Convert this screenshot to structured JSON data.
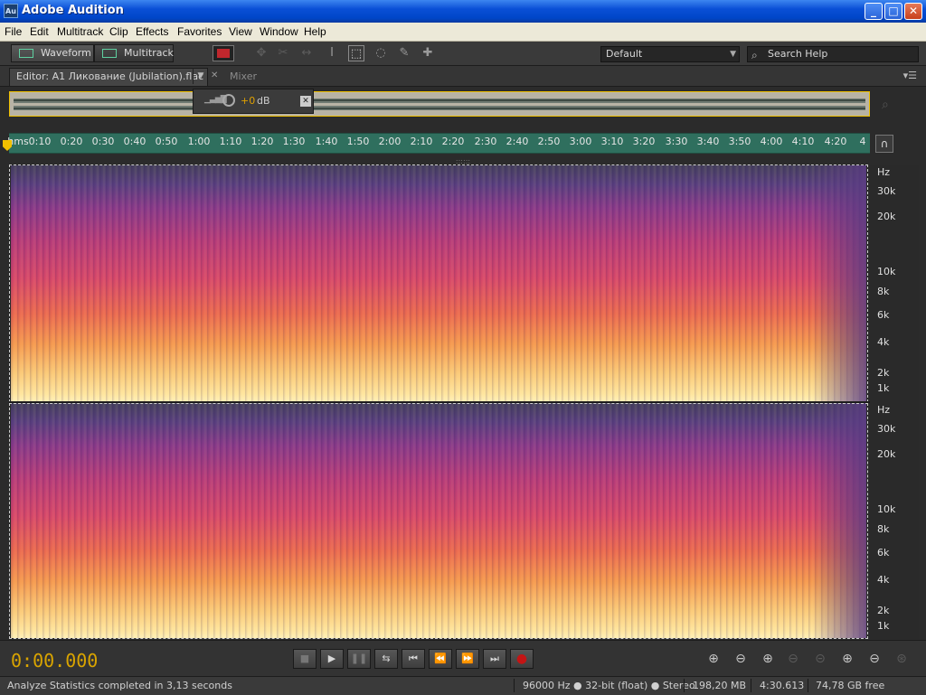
{
  "window": {
    "app_icon": "Au",
    "title": "Adobe Audition",
    "btn_min": "_",
    "btn_max": "□",
    "btn_close": "✕"
  },
  "menu": [
    "File",
    "Edit",
    "Multitrack",
    "Clip",
    "Effects",
    "Favorites",
    "View",
    "Window",
    "Help"
  ],
  "toolbar": {
    "waveform_label": "Waveform",
    "multitrack_label": "Multitrack",
    "workspace": "Default",
    "search_placeholder": "Search Help"
  },
  "panel": {
    "editor_tab": "Editor: A1 Ликование (Jubilation).flac",
    "mixer_tab": "Mixer"
  },
  "hud": {
    "volume": "+0",
    "unit": "dB"
  },
  "ruler": {
    "labels": [
      "hms",
      "0:10",
      "0:20",
      "0:30",
      "0:40",
      "0:50",
      "1:00",
      "1:10",
      "1:20",
      "1:30",
      "1:40",
      "1:50",
      "2:00",
      "2:10",
      "2:20",
      "2:30",
      "2:40",
      "2:50",
      "3:00",
      "3:10",
      "3:20",
      "3:30",
      "3:40",
      "3:50",
      "4:00",
      "4:10",
      "4:20",
      "4"
    ]
  },
  "freq_scale": {
    "unit": "Hz",
    "labels": [
      "30k",
      "20k",
      "10k",
      "8k",
      "6k",
      "4k",
      "2k",
      "1k"
    ]
  },
  "transport": {
    "time": "0:00.000",
    "buttons": {
      "stop": "■",
      "play": "▶",
      "pause": "❚❚",
      "loop": "⇆",
      "to_start": "⏮",
      "rewind": "⏪",
      "fast_forward": "⏩",
      "to_end": "⏭",
      "record": "●"
    }
  },
  "status": {
    "message": "Analyze Statistics completed in 3,13 seconds",
    "format": "96000 Hz ● 32-bit (float) ● Stereo",
    "size": "198,20 MB",
    "duration": "4:30.613",
    "free": "74,78 GB free"
  }
}
